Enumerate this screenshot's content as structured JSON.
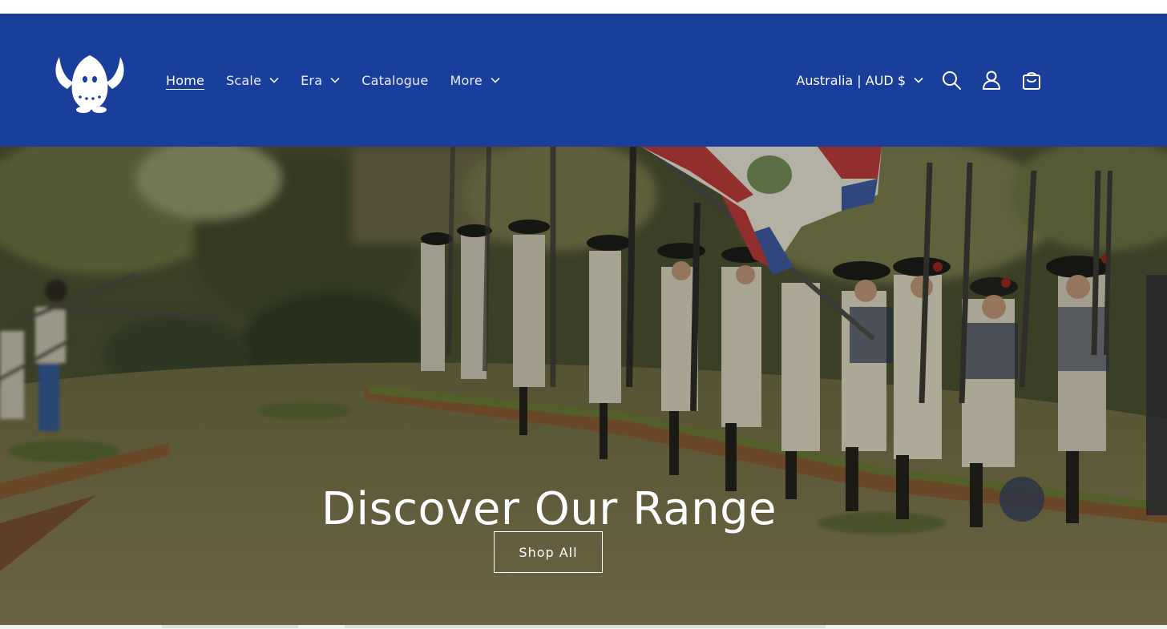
{
  "header": {
    "logo_icon": "viking-helmet-mascot-logo",
    "nav": [
      {
        "label": "Home",
        "active": true,
        "dropdown": false
      },
      {
        "label": "Scale",
        "active": false,
        "dropdown": true
      },
      {
        "label": "Era",
        "active": false,
        "dropdown": true
      },
      {
        "label": "Catalogue",
        "active": false,
        "dropdown": false
      },
      {
        "label": "More",
        "active": false,
        "dropdown": true
      }
    ],
    "locale_label": "Australia | AUD $",
    "icons": [
      "search-icon",
      "account-icon",
      "cart-icon"
    ]
  },
  "hero": {
    "title": "Discover Our Range",
    "button_label": "Shop All"
  },
  "colors": {
    "header_bg": "#1a3e9b",
    "header_text": "#ffffff"
  }
}
